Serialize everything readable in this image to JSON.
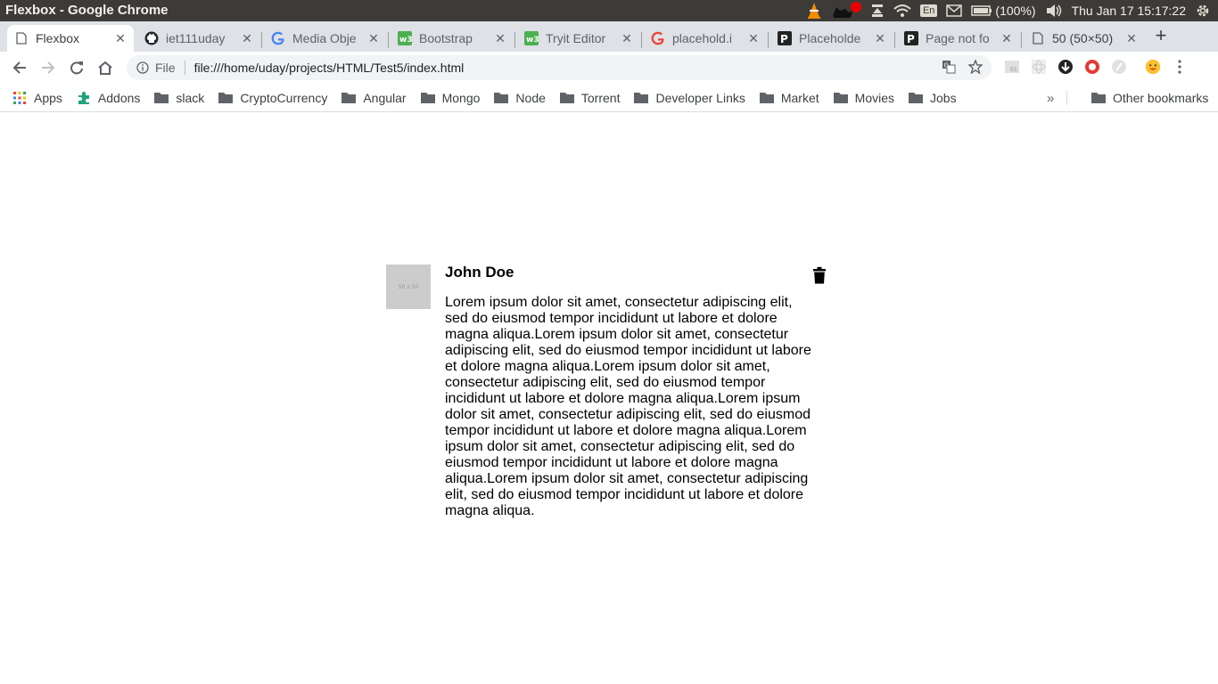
{
  "os": {
    "window_title": "Flexbox - Google Chrome",
    "keyboard_layout": "En",
    "battery": "(100%)",
    "clock": "Thu Jan 17 15:17:22"
  },
  "tabs": [
    {
      "label": "Flexbox",
      "icon": "page-icon",
      "active": true
    },
    {
      "label": "iet111uday",
      "icon": "github-icon"
    },
    {
      "label": "Media Obje",
      "icon": "google-icon"
    },
    {
      "label": "Bootstrap",
      "icon": "w3schools-icon"
    },
    {
      "label": "Tryit Editor",
      "icon": "w3schools-icon"
    },
    {
      "label": "placehold.i",
      "icon": "google-icon"
    },
    {
      "label": "Placeholde",
      "icon": "p-icon"
    },
    {
      "label": "Page not fo",
      "icon": "p-icon"
    },
    {
      "label": "50 (50×50)",
      "icon": "page-icon"
    }
  ],
  "toolbar": {
    "scheme_label": "File",
    "url": "file:///home/uday/projects/HTML/Test5/index.html"
  },
  "bookmarks": {
    "items": [
      "Apps",
      "Addons",
      "slack",
      "CryptoCurrency",
      "Angular",
      "Mongo",
      "Node",
      "Torrent",
      "Developer Links",
      "Market",
      "Movies",
      "Jobs"
    ],
    "more": "»",
    "other": "Other bookmarks"
  },
  "content": {
    "thumbnail_text": "50 x 50",
    "heading": "John Doe",
    "body": "Lorem ipsum dolor sit amet, consectetur adipiscing elit, sed do eiusmod tempor incididunt ut labore et dolore magna aliqua.Lorem ipsum dolor sit amet, consectetur adipiscing elit, sed do eiusmod tempor incididunt ut labore et dolore magna aliqua.Lorem ipsum dolor sit amet, consectetur adipiscing elit, sed do eiusmod tempor incididunt ut labore et dolore magna aliqua.Lorem ipsum dolor sit amet, consectetur adipiscing elit, sed do eiusmod tempor incididunt ut labore et dolore magna aliqua.Lorem ipsum dolor sit amet, consectetur adipiscing elit, sed do eiusmod tempor incididunt ut labore et dolore magna aliqua.Lorem ipsum dolor sit amet, consectetur adipiscing elit, sed do eiusmod tempor incididunt ut labore et dolore magna aliqua.",
    "delete_icon": "trash-icon"
  },
  "colors": {
    "os_bar": "#3c3b37",
    "tabstrip": "#dee1e6",
    "omnibox": "#f1f3f4",
    "thumbnail": "#cccccc"
  }
}
